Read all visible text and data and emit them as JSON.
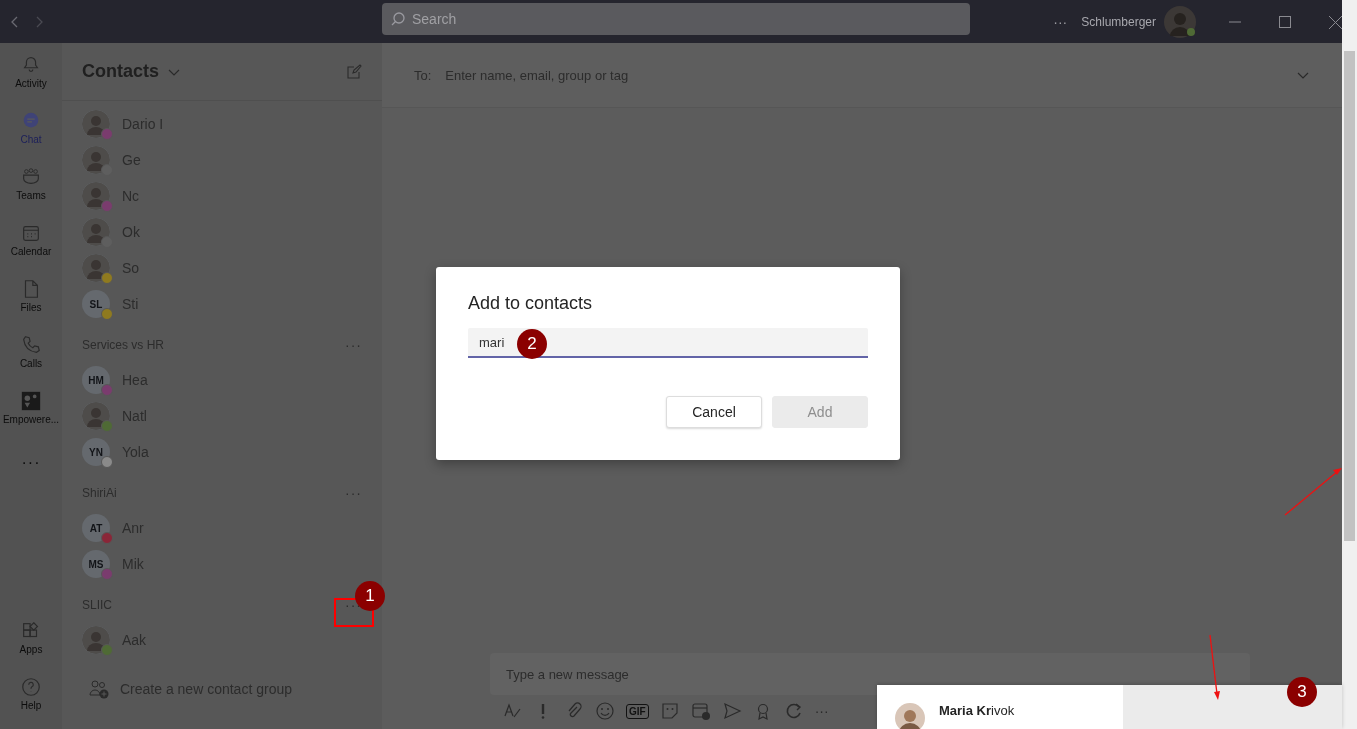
{
  "title_bar": {
    "search": {
      "placeholder": "Search"
    },
    "more": "···",
    "org": "Schlumberger"
  },
  "rail": [
    {
      "label": "Activity",
      "selected": false
    },
    {
      "label": "Chat",
      "selected": true
    },
    {
      "label": "Teams",
      "selected": false
    },
    {
      "label": "Calendar",
      "selected": false
    },
    {
      "label": "Files",
      "selected": false
    },
    {
      "label": "Calls",
      "selected": false
    },
    {
      "label": "Empowere...",
      "selected": false
    },
    {
      "label": "···",
      "selected": false
    }
  ],
  "rail_bottom": [
    {
      "label": "Apps",
      "selected": false
    },
    {
      "label": "Help",
      "selected": false
    }
  ],
  "contacts": {
    "title": "Contacts",
    "items": [
      {
        "kind": "contact",
        "name": "Dario I",
        "color": "#7a3c6e"
      },
      {
        "kind": "contact",
        "name": "Ge",
        "color": "#5e5e5e"
      },
      {
        "kind": "contact",
        "name": "Nc",
        "color": "#7a3c6e"
      },
      {
        "kind": "contact",
        "name": "Ok",
        "color": "#5e5e5e"
      },
      {
        "kind": "contact",
        "name": "So",
        "color": "#8f7a1f"
      },
      {
        "kind": "contact",
        "name": "Sti",
        "initials": "SL",
        "color": "#8f7a1f"
      },
      {
        "kind": "group",
        "name": "Services vs HR",
        "more": "···"
      },
      {
        "kind": "contact",
        "name": "Hea",
        "initials": "HM",
        "color": "#7a3c6e"
      },
      {
        "kind": "contact",
        "name": "Natl",
        "color": "#4f6a35"
      },
      {
        "kind": "contact",
        "name": "Yola",
        "initials": "YN",
        "color": "#8a8a8a"
      },
      {
        "kind": "group",
        "name": "ShiriAi",
        "more": "···"
      },
      {
        "kind": "contact",
        "name": "Anr",
        "initials": "AT",
        "color": "#8a2638"
      },
      {
        "kind": "contact",
        "name": "Mik",
        "initials": "MS",
        "color": "#7a3c6e"
      },
      {
        "kind": "group",
        "name": "SLIIC",
        "more": "···"
      },
      {
        "kind": "contact",
        "name": "Aak",
        "color": "#4f6a35"
      }
    ],
    "create_group": "Create a new contact group"
  },
  "compose": {
    "to_label": "To:",
    "to_placeholder": "Enter name, email, group or tag",
    "message_placeholder": "Type a new message",
    "gif": "GIF",
    "more": "···"
  },
  "dialog": {
    "title": "Add to contacts",
    "value": "mari",
    "cancel": "Cancel",
    "add": "Add",
    "add_disabled": true
  },
  "suggestion": {
    "name": "**Maria Kr**ivok"
  },
  "annotations": [
    {
      "label": "1"
    },
    {
      "label": "2"
    },
    {
      "label": "3"
    }
  ]
}
